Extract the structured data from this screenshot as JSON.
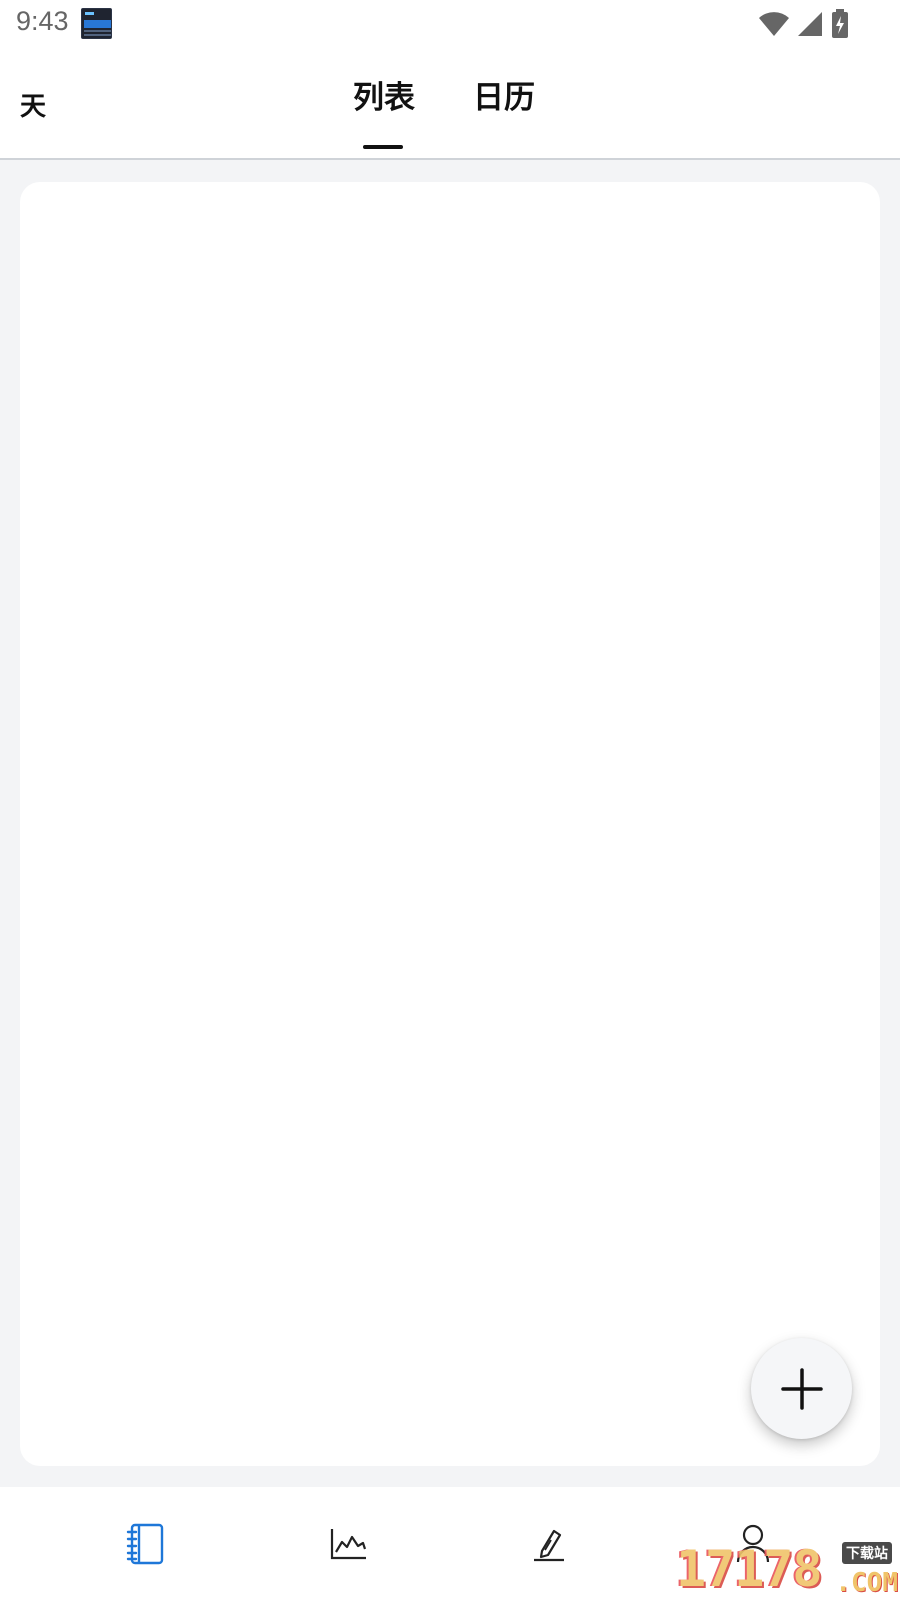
{
  "status_bar": {
    "time": "9:43",
    "icons": [
      "notification-clock-icon",
      "wifi-icon",
      "cellular-signal-icon",
      "battery-charging-icon"
    ]
  },
  "header": {
    "left_label": "天",
    "tabs": [
      {
        "label": "列表",
        "active": true
      },
      {
        "label": "日历",
        "active": false
      }
    ]
  },
  "fab": {
    "icon": "plus-icon"
  },
  "bottom_nav": {
    "items": [
      {
        "icon": "notebook-icon",
        "active": true,
        "color": "#1e77d8"
      },
      {
        "icon": "chart-icon",
        "active": false,
        "color": "#222222"
      },
      {
        "icon": "pen-icon",
        "active": false,
        "color": "#222222"
      },
      {
        "icon": "profile-icon",
        "active": false,
        "color": "#222222"
      }
    ]
  },
  "watermark": {
    "main": "17178",
    "badge": "下载站",
    "domain": ".COM"
  },
  "colors": {
    "accent": "#1e77d8",
    "page_background": "#f3f4f6",
    "card_background": "#ffffff",
    "text": "#111111"
  }
}
